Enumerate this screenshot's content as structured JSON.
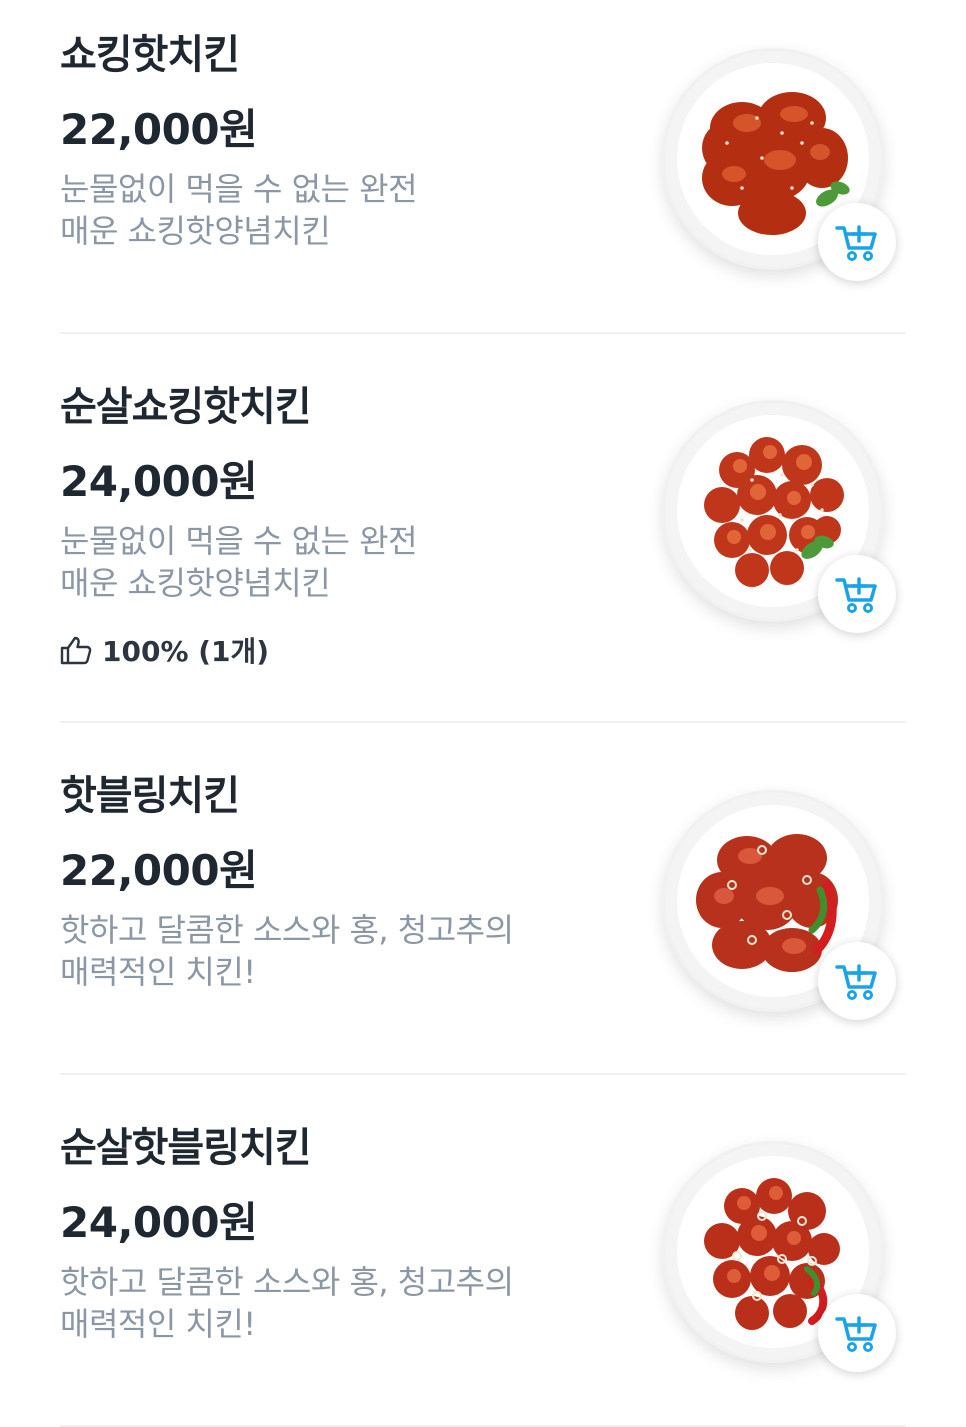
{
  "menu": {
    "items": [
      {
        "name": "쇼킹핫치킨",
        "price": "22,000원",
        "description_lines": [
          "눈물없이 먹을 수 없는 완전",
          "매운 쇼킹핫양념치킨"
        ],
        "image_icon": "fried-chicken-plate"
      },
      {
        "name": "순살쇼킹핫치킨",
        "price": "24,000원",
        "description_lines": [
          "눈물없이 먹을 수 없는 완전",
          "매운 쇼킹핫양념치킨"
        ],
        "rating": "100% (1개)",
        "rating_icon": "thumbs-up-icon",
        "image_icon": "fried-chicken-plate"
      },
      {
        "name": "핫블링치킨",
        "price": "22,000원",
        "description_lines": [
          "핫하고 달콤한 소스와 홍, 청고추의",
          "매력적인 치킨!"
        ],
        "image_icon": "fried-chicken-plate"
      },
      {
        "name": "순살핫블링치킨",
        "price": "24,000원",
        "description_lines": [
          "핫하고 달콤한 소스와 홍, 청고추의",
          "매력적인 치킨!"
        ],
        "image_icon": "fried-chicken-plate"
      }
    ],
    "cart_icon": "add-to-cart-icon"
  },
  "colors": {
    "title": "#1f2730",
    "description": "#8b97a4",
    "cart_accent": "#1aa3e8",
    "divider": "#eef0f2"
  }
}
